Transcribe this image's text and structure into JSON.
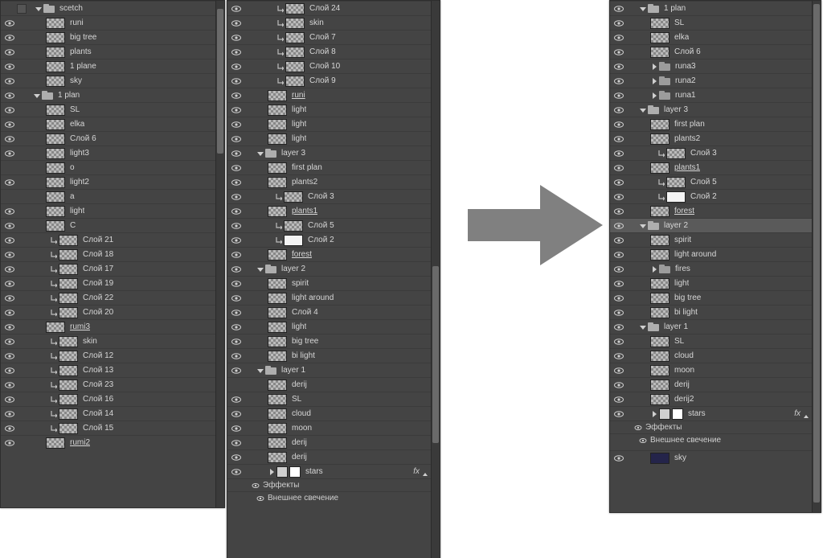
{
  "panel1": {
    "rows": [
      {
        "kind": "group",
        "eye": false,
        "chev": "down",
        "indent": 8,
        "label": "scetch",
        "box": true
      },
      {
        "kind": "layer",
        "eye": true,
        "indent": 24,
        "label": "runi"
      },
      {
        "kind": "layer",
        "eye": true,
        "indent": 24,
        "label": "big tree"
      },
      {
        "kind": "layer",
        "eye": true,
        "indent": 24,
        "label": "plants"
      },
      {
        "kind": "layer",
        "eye": true,
        "indent": 24,
        "label": "1 plane"
      },
      {
        "kind": "layer",
        "eye": true,
        "indent": 24,
        "label": "sky"
      },
      {
        "kind": "group",
        "eye": true,
        "chev": "down",
        "indent": 8,
        "label": "1 plan"
      },
      {
        "kind": "layer",
        "eye": true,
        "indent": 24,
        "label": "SL"
      },
      {
        "kind": "layer",
        "eye": true,
        "indent": 24,
        "label": "elka"
      },
      {
        "kind": "layer",
        "eye": true,
        "indent": 24,
        "label": "Слой 6"
      },
      {
        "kind": "layer",
        "eye": true,
        "indent": 24,
        "label": "light3"
      },
      {
        "kind": "layer",
        "eye": false,
        "indent": 24,
        "label": "o"
      },
      {
        "kind": "layer",
        "eye": true,
        "indent": 24,
        "label": "light2"
      },
      {
        "kind": "layer",
        "eye": false,
        "indent": 24,
        "label": "a"
      },
      {
        "kind": "layer",
        "eye": true,
        "indent": 24,
        "label": "light"
      },
      {
        "kind": "layer",
        "eye": true,
        "indent": 24,
        "label": "C"
      },
      {
        "kind": "clip",
        "eye": true,
        "indent": 30,
        "label": "Слой 21"
      },
      {
        "kind": "clip",
        "eye": true,
        "indent": 30,
        "label": "Слой 18"
      },
      {
        "kind": "clip",
        "eye": true,
        "indent": 30,
        "label": "Слой 17"
      },
      {
        "kind": "clip",
        "eye": true,
        "indent": 30,
        "label": "Слой 19"
      },
      {
        "kind": "clip",
        "eye": true,
        "indent": 30,
        "label": "Слой 22"
      },
      {
        "kind": "clip",
        "eye": true,
        "indent": 30,
        "label": "Слой 20"
      },
      {
        "kind": "layer",
        "eye": true,
        "indent": 24,
        "label": "rumi3",
        "u": true
      },
      {
        "kind": "clip",
        "eye": true,
        "indent": 30,
        "label": "skin"
      },
      {
        "kind": "clip",
        "eye": true,
        "indent": 30,
        "label": "Слой 12"
      },
      {
        "kind": "clip",
        "eye": true,
        "indent": 30,
        "label": "Слой 13"
      },
      {
        "kind": "clip",
        "eye": true,
        "indent": 30,
        "label": "Слой 23"
      },
      {
        "kind": "clip",
        "eye": true,
        "indent": 30,
        "label": "Слой 16"
      },
      {
        "kind": "clip",
        "eye": true,
        "indent": 30,
        "label": "Слой 14"
      },
      {
        "kind": "clip",
        "eye": true,
        "indent": 30,
        "label": "Слой 15"
      },
      {
        "kind": "layer",
        "eye": true,
        "indent": 24,
        "label": "rumi2",
        "u": true
      }
    ]
  },
  "panel2": {
    "rows": [
      {
        "kind": "clip",
        "eye": true,
        "indent": 30,
        "label": "Слой 24"
      },
      {
        "kind": "clip",
        "eye": true,
        "indent": 30,
        "label": "skin"
      },
      {
        "kind": "clip",
        "eye": true,
        "indent": 30,
        "label": "Слой 7"
      },
      {
        "kind": "clip",
        "eye": true,
        "indent": 30,
        "label": "Слой 8"
      },
      {
        "kind": "clip",
        "eye": true,
        "indent": 30,
        "label": "Слой 10"
      },
      {
        "kind": "clip",
        "eye": true,
        "indent": 30,
        "label": "Слой 9"
      },
      {
        "kind": "layer",
        "eye": true,
        "indent": 18,
        "label": "runi",
        "u": true
      },
      {
        "kind": "layer",
        "eye": true,
        "indent": 18,
        "label": "light"
      },
      {
        "kind": "layer",
        "eye": true,
        "indent": 18,
        "label": "light"
      },
      {
        "kind": "layer",
        "eye": true,
        "indent": 18,
        "label": "light"
      },
      {
        "kind": "group",
        "eye": true,
        "chev": "down",
        "indent": 4,
        "label": "layer 3"
      },
      {
        "kind": "layer",
        "eye": true,
        "indent": 18,
        "label": "first plan"
      },
      {
        "kind": "layer",
        "eye": true,
        "indent": 18,
        "label": "plants2"
      },
      {
        "kind": "clip",
        "eye": true,
        "indent": 28,
        "label": "Слой 3"
      },
      {
        "kind": "layer",
        "eye": true,
        "indent": 18,
        "label": "plants1",
        "u": true
      },
      {
        "kind": "clip",
        "eye": true,
        "indent": 28,
        "label": "Слой 5"
      },
      {
        "kind": "clip",
        "eye": true,
        "indent": 28,
        "label": "Слой 2",
        "white": true
      },
      {
        "kind": "layer",
        "eye": true,
        "indent": 18,
        "label": "forest",
        "u": true
      },
      {
        "kind": "group",
        "eye": true,
        "chev": "down",
        "indent": 4,
        "label": "layer 2"
      },
      {
        "kind": "layer",
        "eye": true,
        "indent": 18,
        "label": "spirit"
      },
      {
        "kind": "layer",
        "eye": true,
        "indent": 18,
        "label": "light around"
      },
      {
        "kind": "layer",
        "eye": true,
        "indent": 18,
        "label": "Слой 4"
      },
      {
        "kind": "layer",
        "eye": true,
        "indent": 18,
        "label": "light"
      },
      {
        "kind": "layer",
        "eye": true,
        "indent": 18,
        "label": "big tree"
      },
      {
        "kind": "layer",
        "eye": true,
        "indent": 18,
        "label": "bi light"
      },
      {
        "kind": "group",
        "eye": true,
        "chev": "down",
        "indent": 4,
        "label": "layer 1"
      },
      {
        "kind": "layer",
        "eye": false,
        "indent": 18,
        "label": "derij"
      },
      {
        "kind": "layer",
        "eye": true,
        "indent": 18,
        "label": "SL"
      },
      {
        "kind": "layer",
        "eye": true,
        "indent": 18,
        "label": "cloud"
      },
      {
        "kind": "layer",
        "eye": true,
        "indent": 18,
        "label": "moon"
      },
      {
        "kind": "layer",
        "eye": true,
        "indent": 18,
        "label": "derij"
      },
      {
        "kind": "layer",
        "eye": true,
        "indent": 18,
        "label": "derij"
      },
      {
        "kind": "mask",
        "eye": true,
        "indent": 18,
        "label": "stars",
        "fx": true
      },
      {
        "kind": "fxhead",
        "indent": 28,
        "label": "Эффекты"
      },
      {
        "kind": "fxitem",
        "indent": 34,
        "label": "Внешнее свечение"
      }
    ]
  },
  "panel3": {
    "rows": [
      {
        "kind": "group",
        "eye": true,
        "chev": "down",
        "indent": 4,
        "label": "1 plan"
      },
      {
        "kind": "layer",
        "eye": true,
        "indent": 18,
        "label": "SL"
      },
      {
        "kind": "layer",
        "eye": true,
        "indent": 18,
        "label": "elka"
      },
      {
        "kind": "layer",
        "eye": true,
        "indent": 18,
        "label": "Слой 6"
      },
      {
        "kind": "folder",
        "eye": true,
        "chev": "right",
        "indent": 18,
        "label": "runa3"
      },
      {
        "kind": "folder",
        "eye": true,
        "chev": "right",
        "indent": 18,
        "label": "runa2"
      },
      {
        "kind": "folder",
        "eye": true,
        "chev": "right",
        "indent": 18,
        "label": "runa1"
      },
      {
        "kind": "group",
        "eye": true,
        "chev": "down",
        "indent": 4,
        "label": "layer 3"
      },
      {
        "kind": "layer",
        "eye": true,
        "indent": 18,
        "label": "first plan"
      },
      {
        "kind": "layer",
        "eye": true,
        "indent": 18,
        "label": "plants2"
      },
      {
        "kind": "clip",
        "eye": true,
        "indent": 28,
        "label": "Слой 3"
      },
      {
        "kind": "layer",
        "eye": true,
        "indent": 18,
        "label": "plants1",
        "u": true
      },
      {
        "kind": "clip",
        "eye": true,
        "indent": 28,
        "label": "Слой 5"
      },
      {
        "kind": "clip",
        "eye": true,
        "indent": 28,
        "label": "Слой 2",
        "white": true
      },
      {
        "kind": "layer",
        "eye": true,
        "indent": 18,
        "label": "forest",
        "u": true
      },
      {
        "kind": "group",
        "eye": true,
        "chev": "down",
        "indent": 4,
        "label": "layer 2",
        "sel": true
      },
      {
        "kind": "layer",
        "eye": true,
        "indent": 18,
        "label": "spirit"
      },
      {
        "kind": "layer",
        "eye": true,
        "indent": 18,
        "label": "light around"
      },
      {
        "kind": "folder",
        "eye": true,
        "chev": "right",
        "indent": 18,
        "label": "fires"
      },
      {
        "kind": "layer",
        "eye": true,
        "indent": 18,
        "label": "light"
      },
      {
        "kind": "layer",
        "eye": true,
        "indent": 18,
        "label": "big tree"
      },
      {
        "kind": "layer",
        "eye": true,
        "indent": 18,
        "label": "bi light"
      },
      {
        "kind": "group",
        "eye": true,
        "chev": "down",
        "indent": 4,
        "label": "layer 1"
      },
      {
        "kind": "layer",
        "eye": true,
        "indent": 18,
        "label": "SL"
      },
      {
        "kind": "layer",
        "eye": true,
        "indent": 18,
        "label": "cloud"
      },
      {
        "kind": "layer",
        "eye": true,
        "indent": 18,
        "label": "moon"
      },
      {
        "kind": "layer",
        "eye": true,
        "indent": 18,
        "label": "derij"
      },
      {
        "kind": "layer",
        "eye": true,
        "indent": 18,
        "label": "derij2"
      },
      {
        "kind": "mask",
        "eye": true,
        "indent": 18,
        "label": "stars",
        "fx": true
      },
      {
        "kind": "fxhead",
        "indent": 28,
        "label": "Эффекты"
      },
      {
        "kind": "fxitem",
        "indent": 34,
        "label": "Внешнее свечение"
      },
      {
        "kind": "layer",
        "eye": true,
        "indent": 18,
        "label": "sky",
        "dark": true,
        "gap": true
      }
    ]
  },
  "fx_label": "fx"
}
